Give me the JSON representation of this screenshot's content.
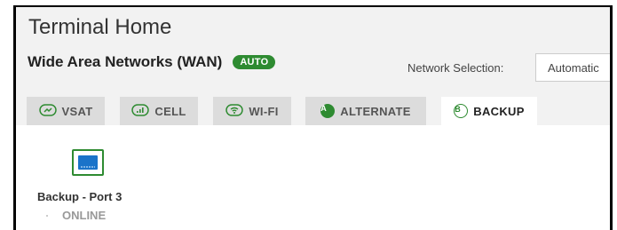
{
  "page": {
    "title": "Terminal Home"
  },
  "wan": {
    "title": "Wide Area Networks (WAN)",
    "badge": "AUTO"
  },
  "network_selection": {
    "label": "Network Selection:",
    "value": "Automatic"
  },
  "tabs": [
    {
      "label": "VSAT",
      "icon": "vsat-icon",
      "active": false
    },
    {
      "label": "CELL",
      "icon": "cell-signal-icon",
      "active": false
    },
    {
      "label": "WI-FI",
      "icon": "wifi-icon",
      "active": false
    },
    {
      "label": "ALTERNATE",
      "icon": "alternate-icon",
      "icon_letter": "A",
      "active": false
    },
    {
      "label": "BACKUP",
      "icon": "backup-icon",
      "icon_letter": "B",
      "active": true
    }
  ],
  "device": {
    "name": "Backup - Port 3",
    "status": "ONLINE",
    "icon": "ethernet-port-icon"
  },
  "colors": {
    "accent": "#2e8b31",
    "port_blue": "#1a73c9",
    "tab_bg": "#dcdcdc",
    "header_bg": "#f2f2f2"
  }
}
